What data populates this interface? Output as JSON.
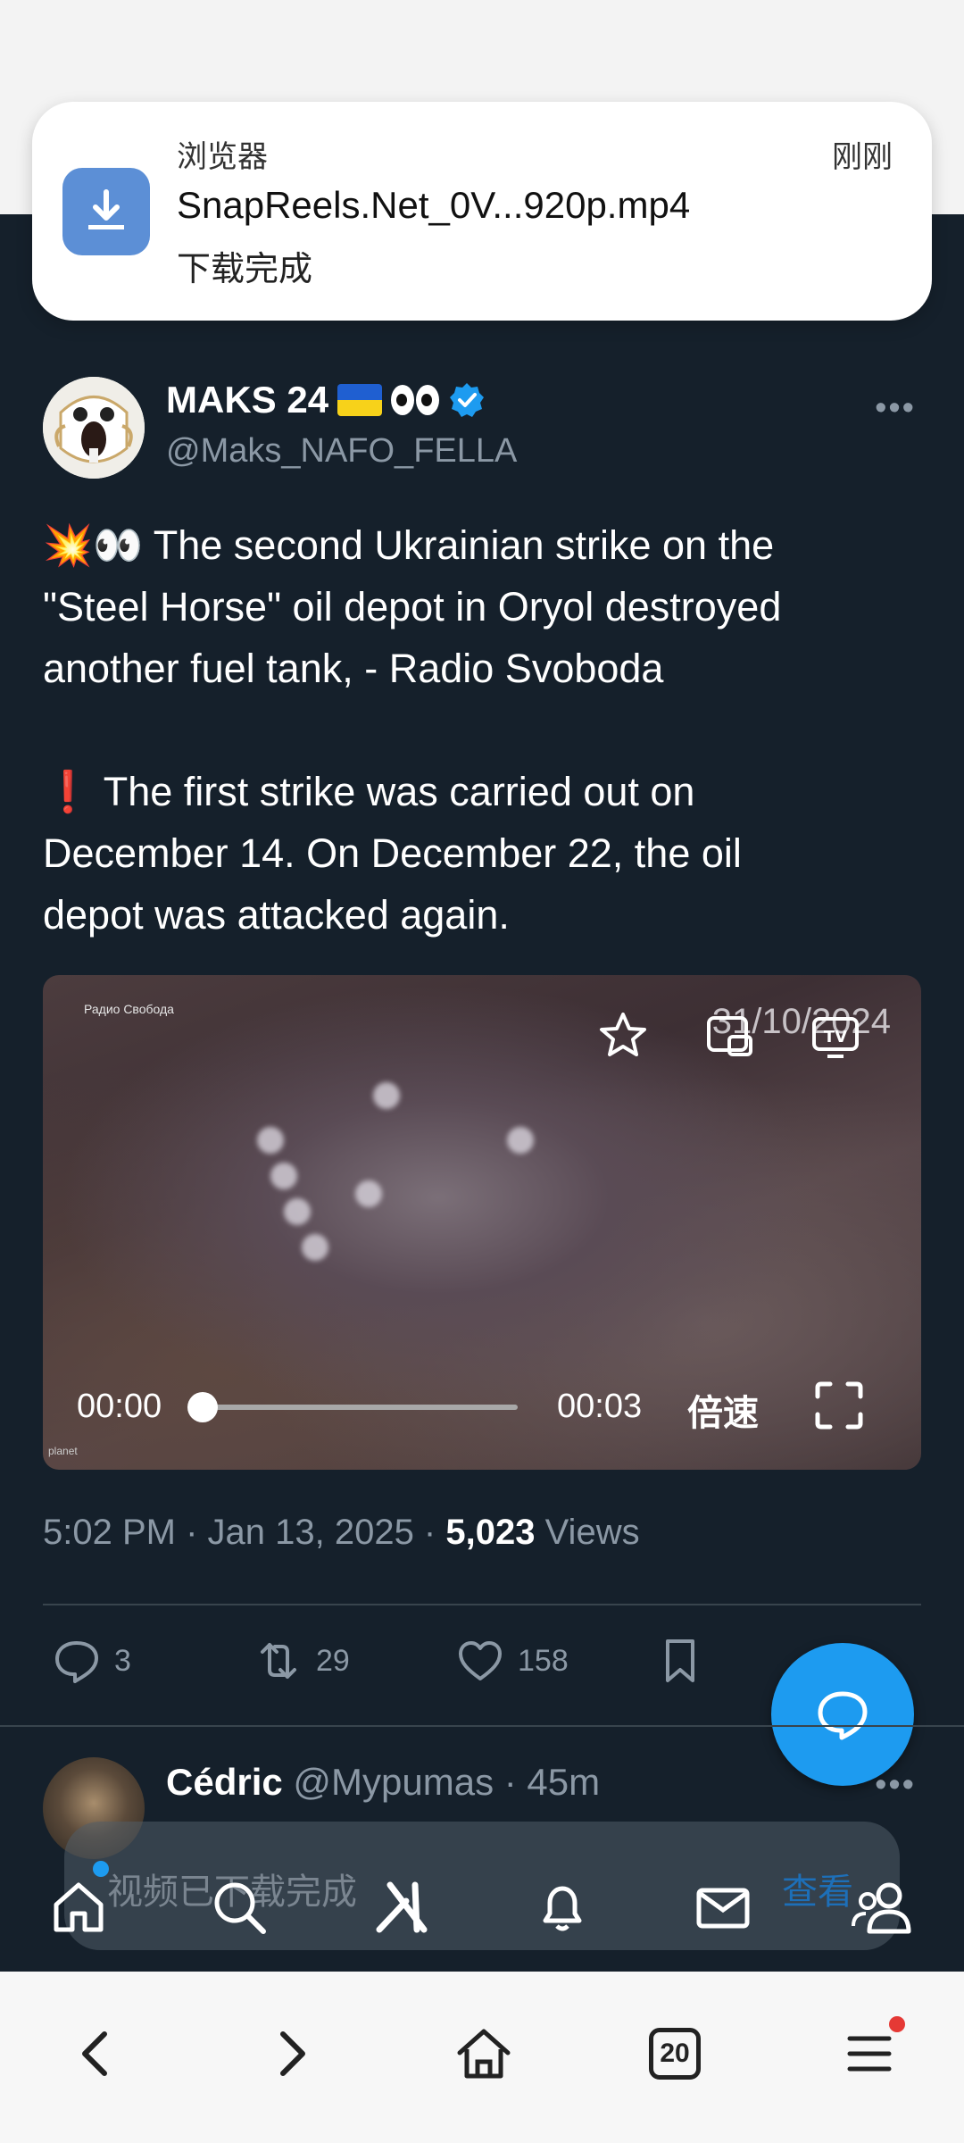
{
  "notification": {
    "app": "浏览器",
    "time": "刚刚",
    "filename": "SnapReels.Net_0V...920p.mp4",
    "status": "下载完成"
  },
  "tweet": {
    "name": "MAKS 24",
    "handle": "@Maks_NAFO_FELLA",
    "line1_emoji": "💥👀",
    "line1": " The second Ukrainian strike on the",
    "line2": "\"Steel Horse\" oil depot in Oryol destroyed",
    "line3": "another fuel tank, - Radio Svoboda",
    "line4_emoji": "❗",
    "line4": " The first strike was carried out on",
    "line5": "December 14. On December 22, the oil",
    "line6": "depot was attacked again.",
    "meta_time": "5:02 PM · Jan 13, 2025 · ",
    "views_count": "5,023",
    "views_label": " Views"
  },
  "video": {
    "watermark": "Радио Свобода",
    "date_overlay": "31/10/2024",
    "current_time": "00:00",
    "duration": "00:03",
    "speed_label": "倍速",
    "planet_label": "planet",
    "progress": 0
  },
  "actions": {
    "replies": "3",
    "reposts": "29",
    "likes": "158"
  },
  "reply": {
    "name": "Cédric",
    "handle": "@Mypumas",
    "time": " · 45m"
  },
  "toast": {
    "text": "视频已下载完成",
    "link": "查看"
  },
  "browser": {
    "tab_count": "20"
  },
  "colors": {
    "background": "#15202b",
    "accent": "#1d9bf0",
    "muted": "#8b98a5"
  }
}
